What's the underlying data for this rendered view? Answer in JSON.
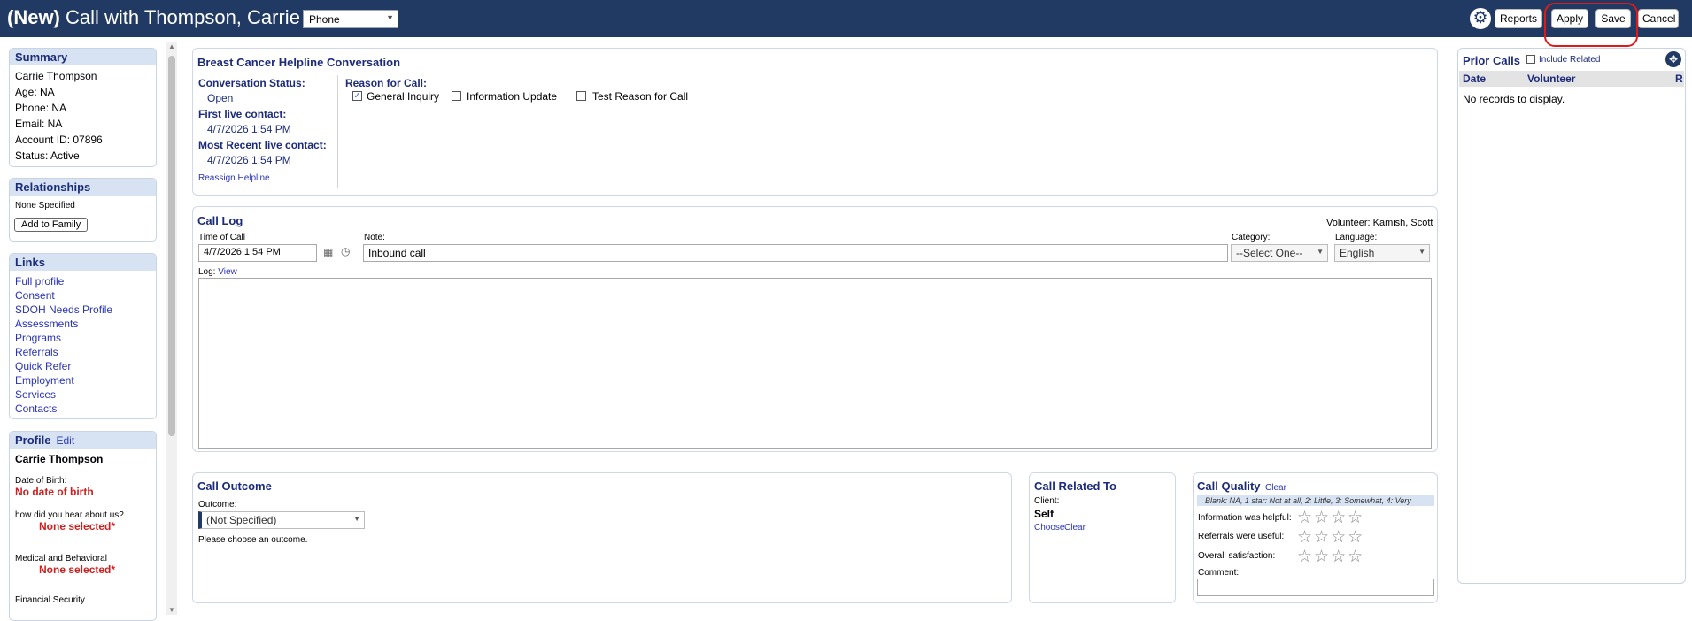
{
  "header": {
    "title_prefix": "(New)",
    "title": "Call with Thompson, Carrie",
    "channel_select": "Phone",
    "reports_label": "Reports",
    "apply_label": "Apply",
    "save_label": "Save",
    "cancel_label": "Cancel"
  },
  "summary": {
    "heading": "Summary",
    "name": "Carrie Thompson",
    "age": "Age: NA",
    "phone": "Phone: NA",
    "email": "Email: NA",
    "account": "Account ID: 07896",
    "status": "Status: Active"
  },
  "relationships": {
    "heading": "Relationships",
    "none": "None Specified",
    "add_button": "Add to Family"
  },
  "links": {
    "heading": "Links",
    "items": [
      "Full profile",
      "Consent",
      "SDOH Needs Profile",
      "Assessments",
      "Programs",
      "Referrals",
      "Quick Refer",
      "Employment",
      "Services",
      "Contacts"
    ]
  },
  "profile": {
    "heading": "Profile",
    "edit": "Edit",
    "name": "Carrie Thompson",
    "dob_label": "Date of Birth:",
    "dob_value": "No date of birth",
    "heard_label": "how did you hear about us?",
    "heard_value": "None selected*",
    "medical_label": "Medical and Behavioral",
    "medical_value": "None selected*",
    "financial_label": "Financial Security"
  },
  "conversation": {
    "title": "Breast Cancer Helpline Conversation",
    "status_label": "Conversation Status:",
    "status_value": "Open",
    "first_label": "First live contact:",
    "first_value": "4/7/2026 1:54 PM",
    "recent_label": "Most Recent live contact:",
    "recent_value": "4/7/2026 1:54 PM",
    "reassign": "Reassign Helpline",
    "reason_label": "Reason for Call:",
    "reasons": [
      {
        "label": "General Inquiry",
        "checked": true
      },
      {
        "label": "Information Update",
        "checked": false
      },
      {
        "label": "Test Reason for Call",
        "checked": false
      }
    ]
  },
  "call_log": {
    "title": "Call Log",
    "volunteer_label": "Volunteer:",
    "volunteer_value": "Kamish, Scott",
    "time_label": "Time of Call",
    "time_value": "4/7/2026 1:54 PM",
    "note_label": "Note:",
    "note_value": "Inbound call",
    "category_label": "Category:",
    "category_value": "--Select One--",
    "language_label": "Language:",
    "language_value": "English",
    "log_label": "Log:",
    "log_view": "View"
  },
  "outcome": {
    "title": "Call Outcome",
    "label": "Outcome:",
    "value": "(Not Specified)",
    "hint": "Please choose an outcome."
  },
  "related": {
    "title": "Call Related To",
    "client_label": "Client:",
    "client_value": "Self",
    "choose": "Choose",
    "clear": "Clear"
  },
  "quality": {
    "title": "Call Quality",
    "clear": "Clear",
    "legend": "Blank: NA, 1 star: Not at all, 2: Little, 3: Somewhat, 4: Very",
    "q1": "Information was helpful:",
    "q2": "Referrals were useful:",
    "q3": "Overall satisfaction:",
    "comment_label": "Comment:",
    "stars": "☆☆☆☆"
  },
  "prior_calls": {
    "title": "Prior Calls",
    "include_related": "Include Related",
    "col_date": "Date",
    "col_volunteer": "Volunteer",
    "col_r": "R",
    "empty": "No records to display."
  }
}
